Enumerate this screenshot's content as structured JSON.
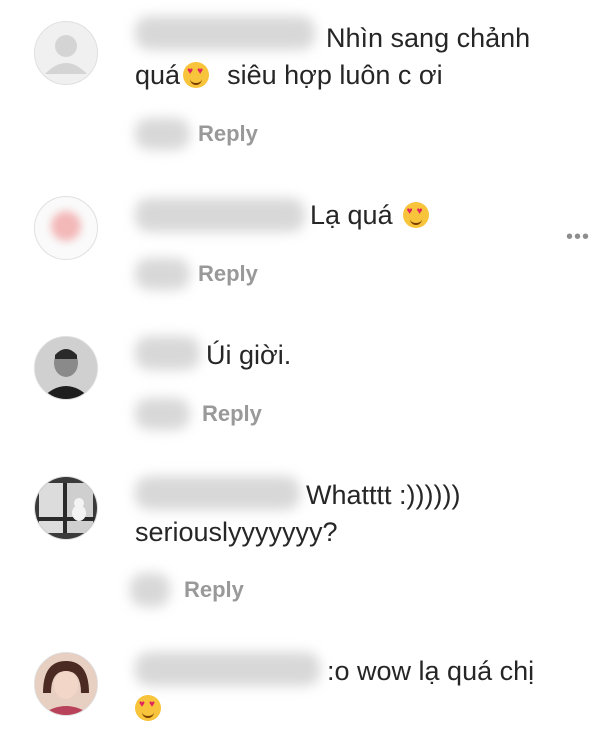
{
  "comments": [
    {
      "line1": "Nhìn sang chảnh",
      "line2a": "quá",
      "line2b": "siêu hợp luôn c ơi",
      "reply": "Reply"
    },
    {
      "line1": "Lạ quá",
      "reply": "Reply"
    },
    {
      "line1": "Úi giời.",
      "reply": "Reply"
    },
    {
      "line1": "Whatttt :))))))",
      "line2": "seriouslyyyyyyy?",
      "reply": "Reply"
    },
    {
      "line1": ":o wow lạ quá chị"
    }
  ],
  "more_icon": "more-horizontal-icon",
  "more_glyph": "•••",
  "emoji_name": "heart-eyes-emoji",
  "colors": {
    "text": "#262626",
    "reply": "#999999",
    "heart": "#e0245e",
    "emoji": "#f7c43b"
  }
}
